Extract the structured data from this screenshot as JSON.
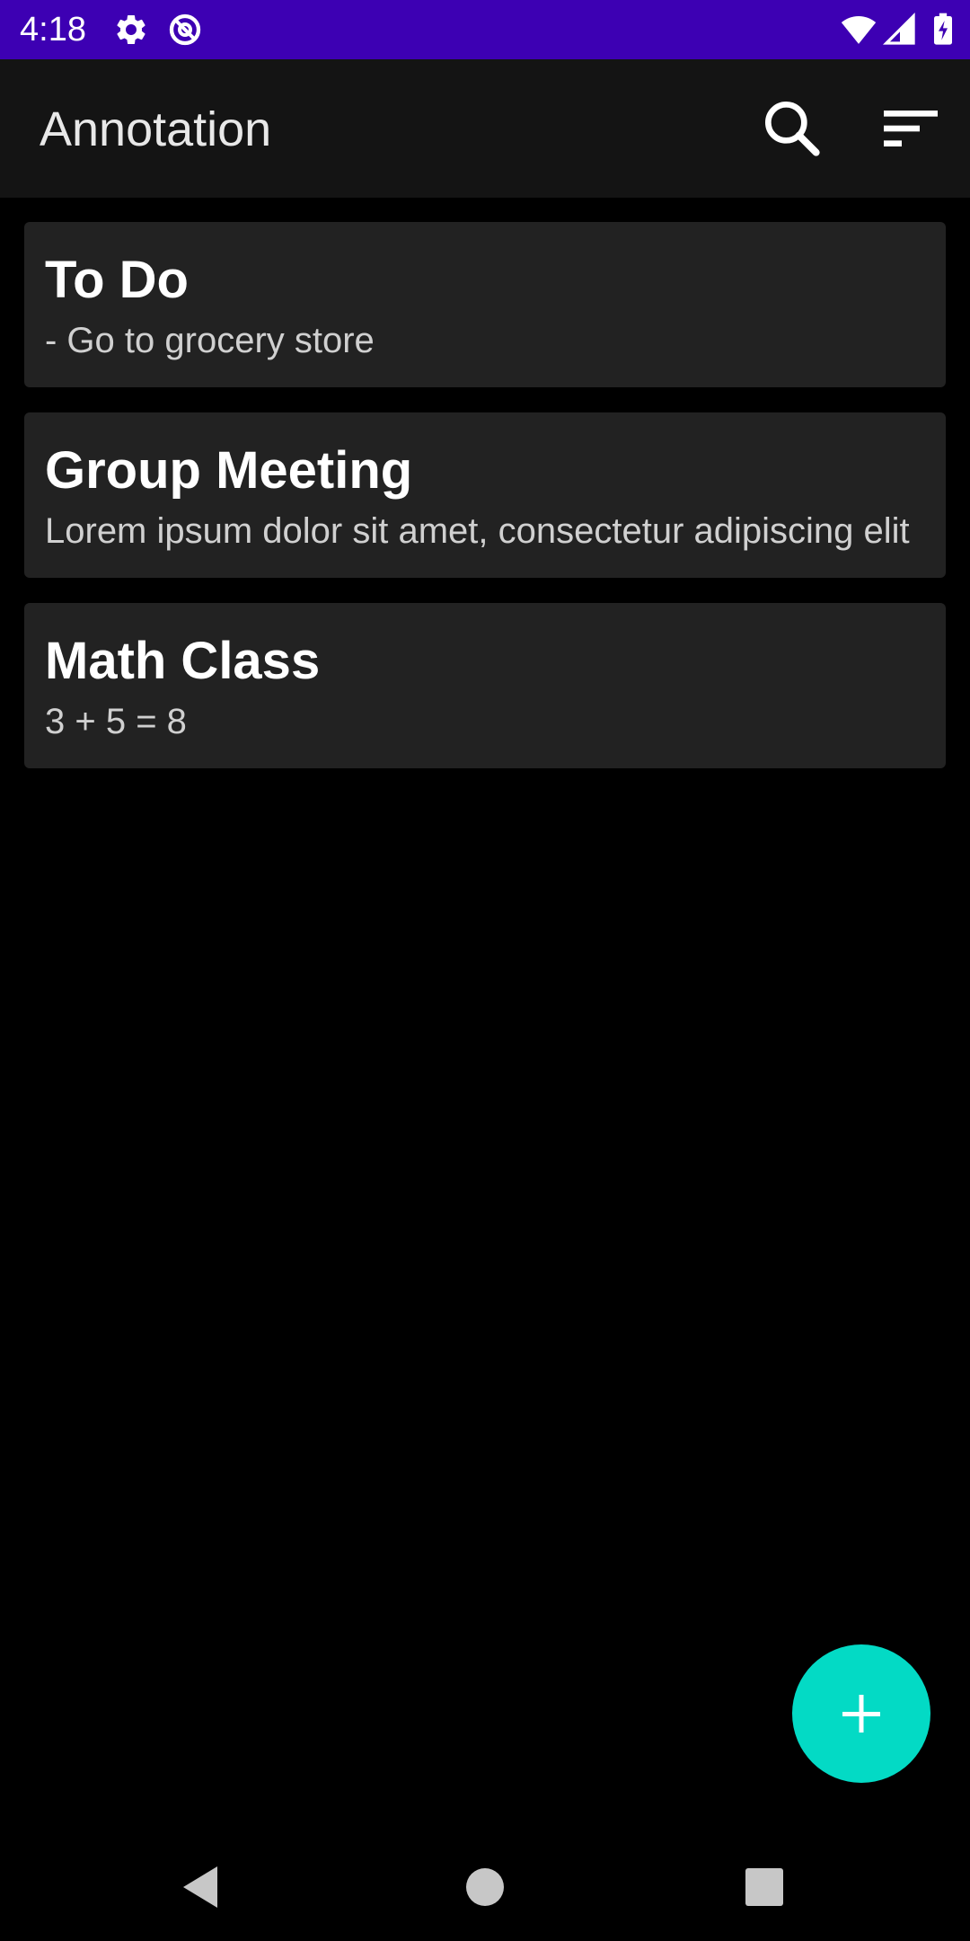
{
  "status_bar": {
    "time": "4:18",
    "icons": [
      "settings-icon",
      "at-sign-icon",
      "wifi-icon",
      "signal-icon",
      "battery-charging-icon"
    ],
    "background": "#3d00b3"
  },
  "app_bar": {
    "title": "Annotation",
    "actions": [
      "search-icon",
      "sort-icon"
    ],
    "background": "#141414"
  },
  "notes": [
    {
      "title": "To Do",
      "body": "- Go to grocery store"
    },
    {
      "title": "Group Meeting",
      "body": "Lorem ipsum dolor sit amet, consectetur adipiscing elit"
    },
    {
      "title": "Math Class",
      "body": "3 + 5 = 8"
    }
  ],
  "fab": {
    "icon": "plus-icon",
    "color": "#03dac5"
  },
  "nav_bar": {
    "buttons": [
      "back-icon",
      "home-icon",
      "recents-icon"
    ]
  }
}
